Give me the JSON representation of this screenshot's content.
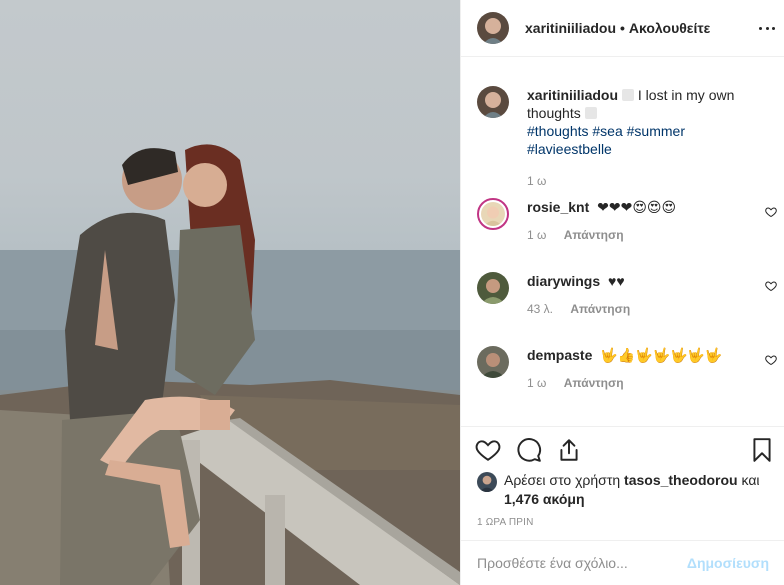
{
  "post": {
    "username": "xaritiniiliadou",
    "separator": "•",
    "follow_state": "Ακολουθείτε"
  },
  "caption": {
    "username": "xaritiniiliadou",
    "text": "I lost in my own thoughts",
    "hashtags": [
      "#thoughts",
      "#sea",
      "#summer",
      "#lavieestbelle"
    ],
    "age": "1 ω"
  },
  "comments": [
    {
      "username": "rosie_knt",
      "text": "❤❤❤😍😍😍",
      "age": "1 ω",
      "reply_label": "Απάντηση"
    },
    {
      "username": "diarywings",
      "text": "♥♥",
      "age": "43 λ.",
      "reply_label": "Απάντηση"
    },
    {
      "username": "dempaste",
      "text": "🤟👍🤟🤟🤟🤟🤟",
      "age": "1 ω",
      "reply_label": "Απάντηση"
    }
  ],
  "likes": {
    "prefix": "Αρέσει στο χρήστη",
    "user": "tasos_theodorou",
    "conj": "και",
    "count": "1,476 ακόμη"
  },
  "timestamp": "1 ΩΡΑ ΠΡΙΝ",
  "add_comment": {
    "placeholder": "Προσθέστε ένα σχόλιο...",
    "post_label": "Δημοσίευση"
  },
  "icons": {
    "like": "heart-icon",
    "comment": "comment-bubble-icon",
    "share": "share-icon",
    "save": "bookmark-icon",
    "more": "more-options-icon"
  }
}
